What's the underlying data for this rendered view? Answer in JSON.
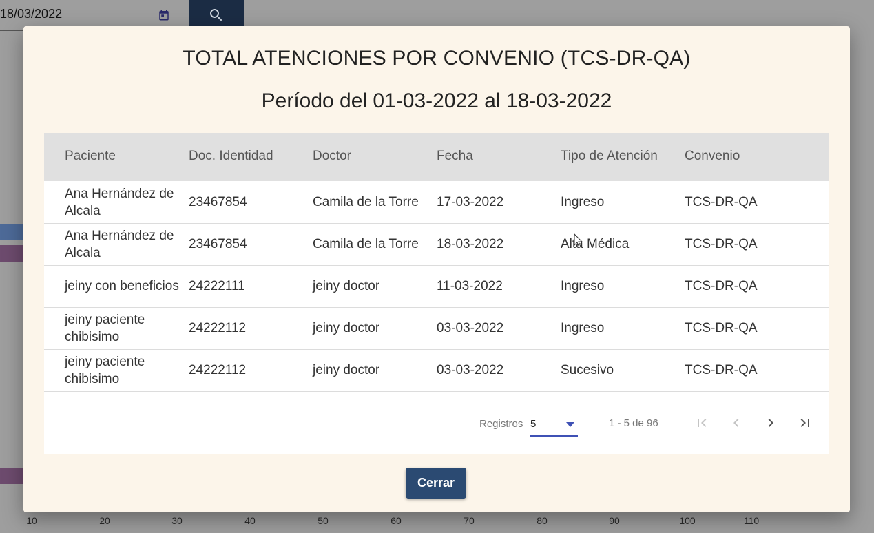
{
  "background": {
    "date_value": "18/03/2022",
    "calendar_icon": "calendar-icon",
    "search_icon": "search-icon",
    "axis_ticks": [
      "10",
      "20",
      "30",
      "40",
      "50",
      "60",
      "70",
      "80",
      "90",
      "100",
      "110"
    ]
  },
  "modal": {
    "title": "TOTAL ATENCIONES POR CONVENIO (TCS-DR-QA)",
    "subtitle": "Período del 01-03-2022 al 18-03-2022",
    "columns": [
      "Paciente",
      "Doc. Identidad",
      "Doctor",
      "Fecha",
      "Tipo de Atención",
      "Convenio"
    ],
    "rows": [
      [
        "Ana Hernández de Alcala",
        "23467854",
        "Camila de la Torre",
        "17-03-2022",
        "Ingreso",
        "TCS-DR-QA"
      ],
      [
        "Ana Hernández de Alcala",
        "23467854",
        "Camila de la Torre",
        "18-03-2022",
        "Alta Médica",
        "TCS-DR-QA"
      ],
      [
        "jeiny con beneficios",
        "24222111",
        "jeiny doctor",
        "11-03-2022",
        "Ingreso",
        "TCS-DR-QA"
      ],
      [
        "jeiny paciente chibisimo",
        "24222112",
        "jeiny doctor",
        "03-03-2022",
        "Ingreso",
        "TCS-DR-QA"
      ],
      [
        "jeiny paciente chibisimo",
        "24222112",
        "jeiny doctor",
        "03-03-2022",
        "Sucesivo",
        "TCS-DR-QA"
      ]
    ],
    "paginator": {
      "label": "Registros",
      "page_size": "5",
      "range": "1 - 5 de 96",
      "icons": [
        "first-page-icon",
        "previous-page-icon",
        "next-page-icon",
        "last-page-icon"
      ]
    },
    "close_label": "Cerrar"
  },
  "colors": {
    "modal_bg": "#fcf5ea",
    "header_bg": "#e0e0e0",
    "button_bg": "#2b4a72",
    "accent": "#3f51b5"
  }
}
